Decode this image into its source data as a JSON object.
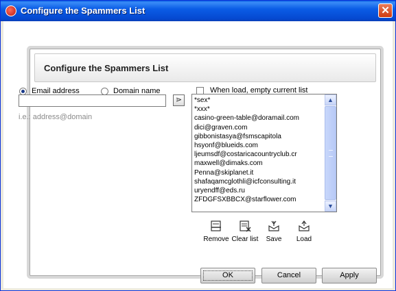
{
  "window": {
    "title": "Configure the Spammers List",
    "close_symbol": "✕"
  },
  "panel": {
    "title": "Configure the Spammers List"
  },
  "type_options": {
    "email_label": "Email address",
    "domain_label": "Domain name",
    "selected": "email"
  },
  "input": {
    "value": "",
    "hint": "i.e.: address@domain",
    "add_button_symbol": "⋗"
  },
  "load_option": {
    "label": "When load, empty current list",
    "checked": false
  },
  "list": {
    "items": [
      "*sex*",
      "*xxx*",
      "casino-green-table@doramail.com",
      "dici@graven.com",
      "gibbonistasya@fsmscapitola",
      "hsyonf@blueids.com",
      "ljeumsdf@costaricacountryclub.cr",
      "maxwell@dimaks.com",
      "Penna@skiplanet.it",
      "shafaqamcglothli@icfconsulting.it",
      "uryendff@eds.ru",
      "ZFDGFSXBBCX@starflower.com"
    ],
    "scroll_up_symbol": "▲",
    "scroll_down_symbol": "▼"
  },
  "actions": {
    "remove": "Remove",
    "clear": "Clear list",
    "save": "Save",
    "load": "Load"
  },
  "buttons": {
    "ok": "OK",
    "cancel": "Cancel",
    "apply": "Apply"
  }
}
